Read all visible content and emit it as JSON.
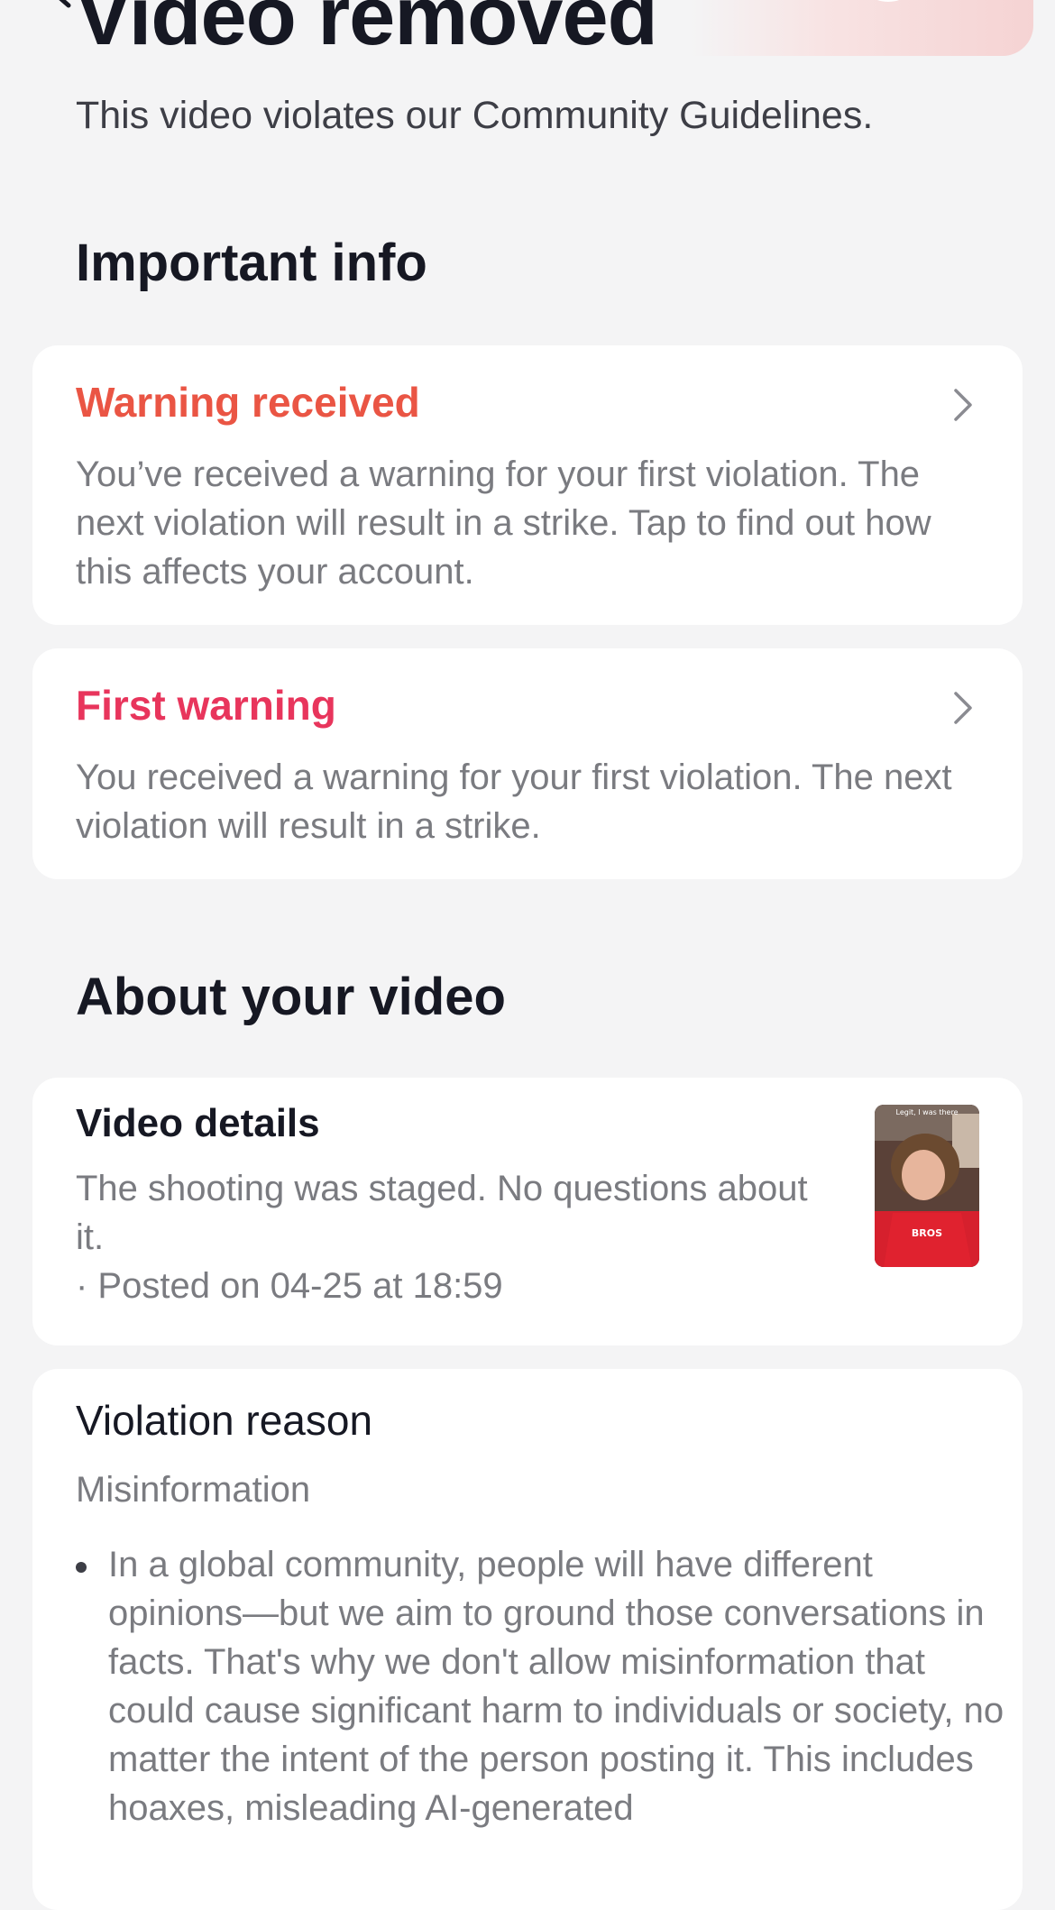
{
  "header": {
    "title": "Video removed",
    "subtitle": "This video violates our Community Guidelines."
  },
  "important_info": {
    "section_title": "Important info",
    "cards": [
      {
        "title": "Warning received",
        "title_color": "#ea5544",
        "body": "You’ve received a warning for your first violation. The next violation will result in a strike. Tap to find out how this affects your account."
      },
      {
        "title": "First warning",
        "title_color": "#e8355c",
        "body": "You received a warning for your first violation. The next violation will result in a strike."
      }
    ]
  },
  "about_video": {
    "section_title": "About your video",
    "details": {
      "title": "Video details",
      "description": "The shooting was staged. No questions about it.",
      "posted": "· Posted on 04-25 at 18:59",
      "thumbnail_caption": "Legit, I was there"
    }
  },
  "violation": {
    "title": "Violation reason",
    "category": "Misinformation",
    "text": "In a global community, people will have different opinions—but we aim to ground those conversations in facts. That's why we don't allow misinformation that could cause significant harm to individuals or society, no matter the intent of the person posting it. This includes hoaxes, misleading AI-generated"
  },
  "colors": {
    "background": "#f4f4f5",
    "card": "#ffffff",
    "text_primary": "#161823",
    "text_secondary": "#7a7b80"
  }
}
